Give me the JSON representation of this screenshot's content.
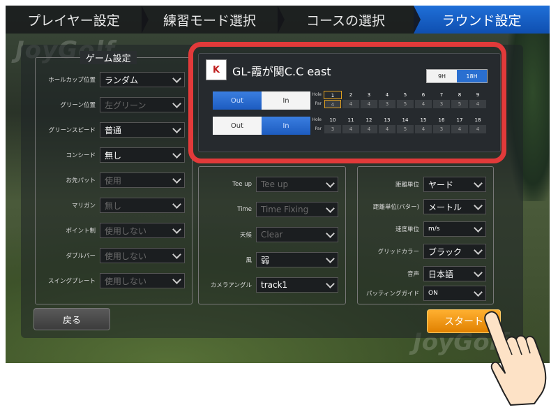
{
  "nav": {
    "steps": [
      {
        "label": "プレイヤー設定"
      },
      {
        "label": "練習モード選択"
      },
      {
        "label": "コースの選択"
      },
      {
        "label": "ラウンド設定"
      }
    ]
  },
  "watermark": "JoyGolf",
  "game_settings": {
    "title": "ゲーム設定",
    "rows": [
      {
        "label": "ホールカップ位置",
        "value": "ランダム"
      },
      {
        "label": "グリーン位置",
        "value": "左グリーン"
      },
      {
        "label": "グリーンスピード",
        "value": "普通"
      },
      {
        "label": "コンシード",
        "value": "無し"
      },
      {
        "label": "お先パット",
        "value": "使用"
      },
      {
        "label": "マリガン",
        "value": "無し"
      },
      {
        "label": "ポイント制",
        "value": "使用しない"
      },
      {
        "label": "ダブルパー",
        "value": "使用しない"
      },
      {
        "label": "スイングプレート",
        "value": "使用しない"
      }
    ]
  },
  "environment": {
    "rows": [
      {
        "label": "Tee up",
        "value": "Tee up"
      },
      {
        "label": "Time",
        "value": "Time Fixing"
      },
      {
        "label": "天候",
        "value": "Clear"
      },
      {
        "label": "風",
        "value": "弱"
      },
      {
        "label": "カメラアングル",
        "value": "track1"
      }
    ]
  },
  "options": {
    "rows": [
      {
        "label": "距離単位",
        "value": "ヤード"
      },
      {
        "label": "距離単位(パター)",
        "value": "メートル"
      },
      {
        "label": "速度単位",
        "value": "m/s"
      },
      {
        "label": "グリッドカラー",
        "value": "ブラック"
      },
      {
        "label": "音声",
        "value": "日本語"
      },
      {
        "label": "パッティングガイド",
        "value": "ON"
      }
    ]
  },
  "course": {
    "logo_text": "K",
    "name": "GL-霞が関C.C east",
    "toggle_9h": "9H",
    "toggle_18h": "18H",
    "front": {
      "out": "Out",
      "in": "In",
      "holes": [
        "1",
        "2",
        "3",
        "4",
        "5",
        "6",
        "7",
        "8",
        "9"
      ],
      "pars": [
        "4",
        "4",
        "4",
        "3",
        "5",
        "4",
        "3",
        "5",
        "4"
      ]
    },
    "back": {
      "out": "Out",
      "in": "In",
      "holes": [
        "10",
        "11",
        "12",
        "13",
        "14",
        "15",
        "16",
        "17",
        "18"
      ],
      "pars": [
        "3",
        "4",
        "4",
        "4",
        "5",
        "4",
        "3",
        "4",
        "4"
      ]
    },
    "hole_label": "Hole",
    "par_label": "Par"
  },
  "buttons": {
    "back": "戻る",
    "start": "スタート"
  },
  "colors": {
    "highlight": "#e23a3a",
    "accent_blue": "#1f6fd8",
    "start_orange": "#f09a20"
  }
}
